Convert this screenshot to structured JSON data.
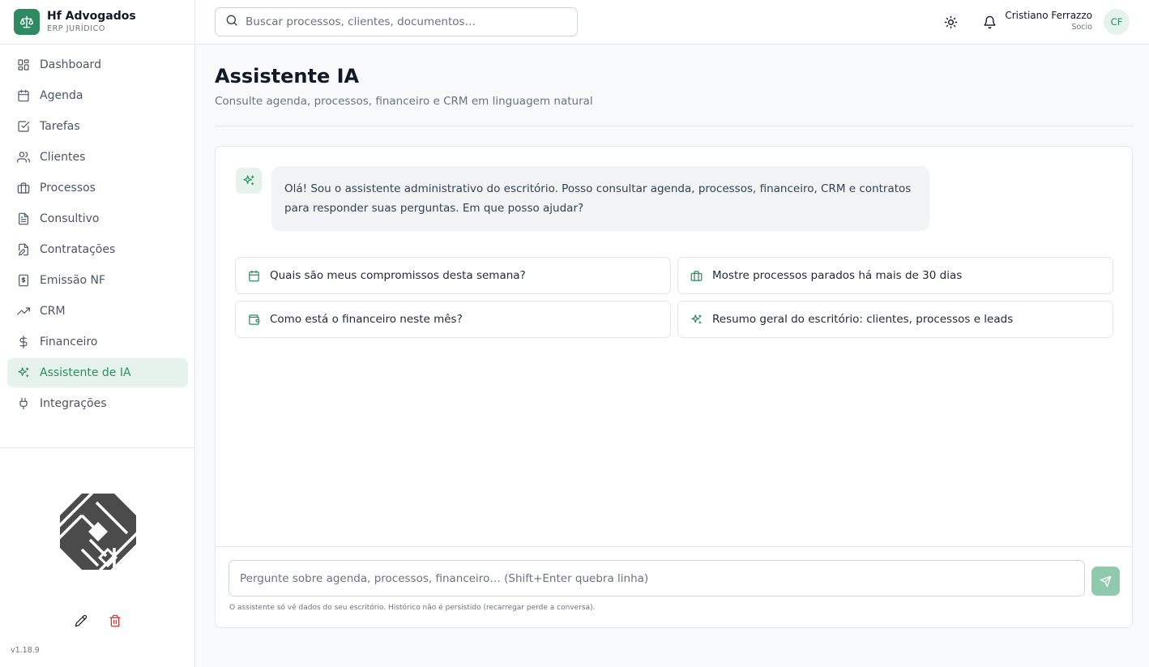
{
  "brand": {
    "name": "Hf Advogados",
    "subtitle": "ERP JURÍDICO"
  },
  "search": {
    "placeholder": "Buscar processos, clientes, documentos…"
  },
  "user": {
    "name": "Cristiano Ferrazzo",
    "role": "Socio",
    "initials": "CF"
  },
  "sidebar": {
    "items": [
      {
        "label": "Dashboard",
        "icon": "dashboard-icon"
      },
      {
        "label": "Agenda",
        "icon": "calendar-icon"
      },
      {
        "label": "Tarefas",
        "icon": "checkbox-icon"
      },
      {
        "label": "Clientes",
        "icon": "users-icon"
      },
      {
        "label": "Processos",
        "icon": "briefcase-icon"
      },
      {
        "label": "Consultivo",
        "icon": "document-icon"
      },
      {
        "label": "Contratações",
        "icon": "file-edit-icon"
      },
      {
        "label": "Emissão NF",
        "icon": "receipt-icon"
      },
      {
        "label": "CRM",
        "icon": "trending-up-icon"
      },
      {
        "label": "Financeiro",
        "icon": "dollar-icon"
      },
      {
        "label": "Assistente de IA",
        "icon": "sparkles-icon",
        "active": true
      },
      {
        "label": "Integrações",
        "icon": "plug-icon"
      }
    ],
    "version": "v1.18.9"
  },
  "page": {
    "title": "Assistente IA",
    "subtitle": "Consulte agenda, processos, financeiro e CRM em linguagem natural"
  },
  "chat": {
    "bot_message": "Olá! Sou o assistente administrativo do escritório. Posso consultar agenda, processos, financeiro, CRM e contratos para responder suas perguntas. Em que posso ajudar?",
    "suggestions": [
      {
        "label": "Quais são meus compromissos desta semana?",
        "icon": "calendar-icon"
      },
      {
        "label": "Mostre processos parados há mais de 30 dias",
        "icon": "briefcase-icon"
      },
      {
        "label": "Como está o financeiro neste mês?",
        "icon": "wallet-icon"
      },
      {
        "label": "Resumo geral do escritório: clientes, processos e leads",
        "icon": "sparkles-icon"
      }
    ],
    "input_placeholder": "Pergunte sobre agenda, processos, financeiro… (Shift+Enter quebra linha)",
    "disclaimer": "O assistente só vê dados do seu escritório. Histórico não é persistido (recarregar perde a conversa)."
  },
  "colors": {
    "accent": "#2e8b61",
    "accent_light": "#e5f3ec",
    "send_disabled": "#8fcaad",
    "danger": "#dc2626"
  }
}
